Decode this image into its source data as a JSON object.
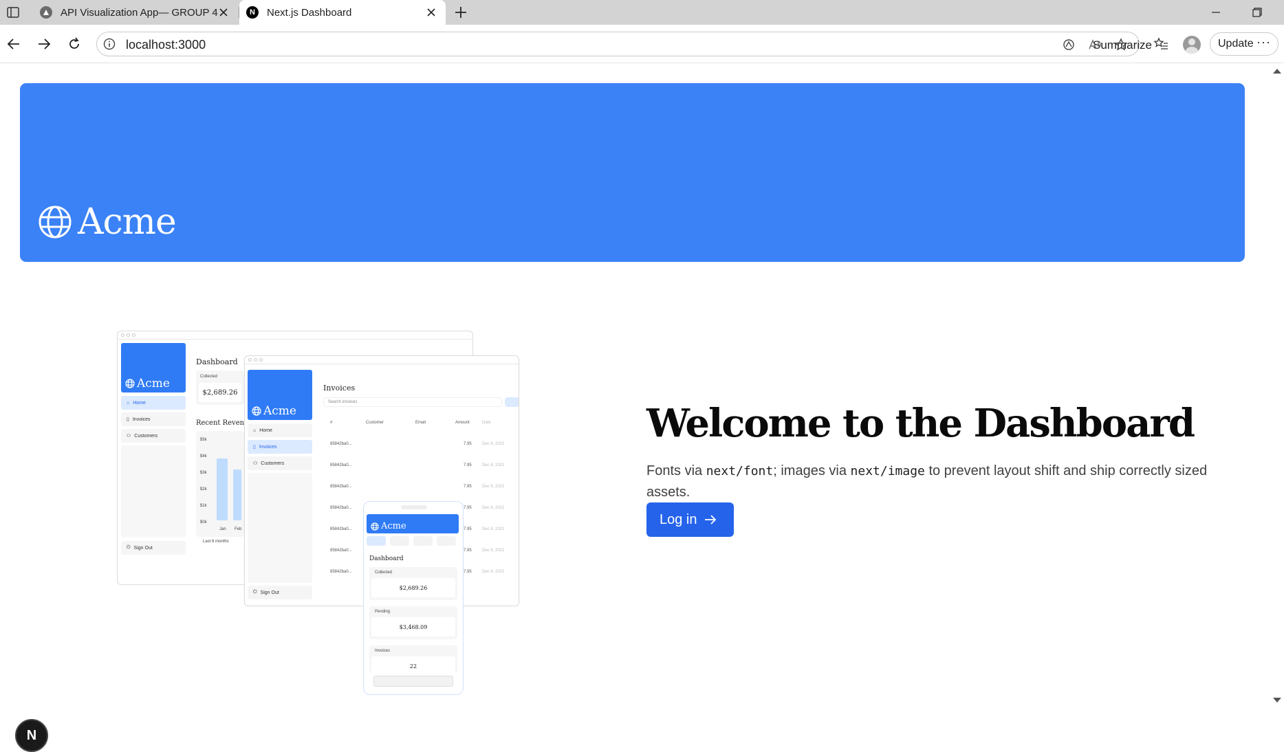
{
  "browser": {
    "tabs": [
      {
        "title": "API Visualization App— GROUP 4",
        "active": false
      },
      {
        "title": "Next.js Dashboard",
        "active": true
      }
    ],
    "favicon_letter": "N",
    "url": "localhost:3000",
    "summarize_label": "Summarize",
    "update_label": "Update",
    "more_label": "···"
  },
  "hero": {
    "brand": "Acme",
    "color": "#3b82f6"
  },
  "main": {
    "heading": "Welcome to the Dashboard",
    "desc_1": "Fonts via ",
    "desc_code_1": "next/font",
    "desc_2": "; images via ",
    "desc_code_2": "next/image",
    "desc_3": " to prevent layout shift and ship correctly sized assets.",
    "login_label": "Log in",
    "login_color": "#2563eb"
  },
  "mockup": {
    "brand": "Acme",
    "desktop": {
      "title": "Dashboard",
      "nav": [
        "Home",
        "Invoices",
        "Customers"
      ],
      "sign_out": "Sign Out",
      "collected_label": "Collected",
      "collected_value": "$2,689.26",
      "revenue_title": "Recent Revenue",
      "y_ticks": [
        "$5k",
        "$4k",
        "$3k",
        "$2k",
        "$1k",
        "$0k"
      ],
      "x_ticks": [
        "Jan",
        "Feb"
      ],
      "footer": "Last 6 months"
    },
    "tablet": {
      "title": "Invoices",
      "nav": [
        "Home",
        "Invoices",
        "Customers"
      ],
      "sign_out": "Sign Out",
      "search_placeholder": "Search invoices",
      "columns": [
        "#",
        "Customer",
        "Email",
        "Amount",
        "Date"
      ],
      "rows": [
        "85842ba0...",
        "85842ba0...",
        "85842ba0...",
        "85842ba0...",
        "85842ba0...",
        "85842ba0...",
        "85842ba0..."
      ],
      "amount": "7.95",
      "date": "Dec 6, 2022"
    },
    "mobile": {
      "title": "Dashboard",
      "collected_label": "Collected",
      "collected_value": "$2,689.26",
      "pending_label": "Pending",
      "pending_value": "$3,468.09",
      "invoices_label": "Invoices",
      "invoices_value": "22"
    }
  }
}
